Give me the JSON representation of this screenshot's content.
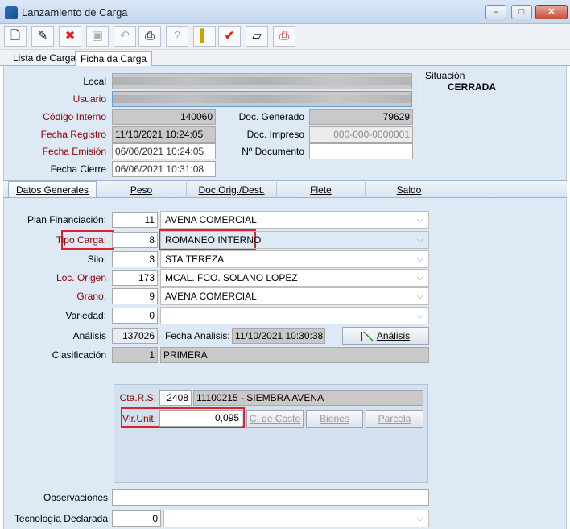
{
  "window": {
    "title": "Lanzamiento de Carga"
  },
  "toolbar": {
    "icons": [
      "new-document-icon",
      "edit-document-icon",
      "delete-document-icon",
      "save-icon",
      "undo-icon",
      "print-icon",
      "help-icon",
      "exit-icon",
      "confirm-icon",
      "eraser-icon",
      "print-report-icon"
    ]
  },
  "tabs": [
    {
      "label": "Lista de Cargas"
    },
    {
      "label": "Ficha da Carga"
    }
  ],
  "header": {
    "local_label": "Local",
    "usuario_label": "Usuario",
    "codigo_interno_label": "Código Interno",
    "codigo_interno": "140060",
    "doc_generado_label": "Doc. Generado",
    "doc_generado": "79629",
    "fecha_registro_label": "Fecha Registro",
    "fecha_registro": "11/10/2021 10:24:05",
    "doc_impreso_label": "Doc. Impreso",
    "doc_impreso": "000-000-0000001",
    "fecha_emision_label": "Fecha Emisión",
    "fecha_emision": "06/06/2021 10:24:05",
    "no_documento_label": "Nº Documento",
    "no_documento": "",
    "fecha_cierre_label": "Fecha Cierre",
    "fecha_cierre": "06/06/2021 10:31:08",
    "situacion_label": "Situación",
    "situacion": "CERRADA"
  },
  "subtabs": [
    {
      "label": "Datos Generales"
    },
    {
      "label": "Peso"
    },
    {
      "label": "Doc.Orig./Dest."
    },
    {
      "label": "Flete"
    },
    {
      "label": "Saldo"
    }
  ],
  "form": {
    "plan_financiacion": {
      "label": "Plan Financiación:",
      "code": "11",
      "value": "AVENA COMERCIAL"
    },
    "tipo_carga": {
      "label": "Tipo Carga:",
      "code": "8",
      "value": "ROMANEO INTERNO"
    },
    "silo": {
      "label": "Silo:",
      "code": "3",
      "value": "STA.TEREZA"
    },
    "loc_origen": {
      "label": "Loc. Origen",
      "code": "173",
      "value": "MCAL. FCO. SOLANO LOPEZ"
    },
    "grano": {
      "label": "Grano:",
      "code": "9",
      "value": "AVENA COMERCIAL"
    },
    "variedad": {
      "label": "Variedad:",
      "code": "0",
      "value": ""
    },
    "analisis": {
      "label": "Análisis",
      "code": "137026",
      "fecha_label": "Fecha Análisis:",
      "fecha": "11/10/2021 10:30:38",
      "button": "Análisis"
    },
    "clasificacion": {
      "label": "Clasificación",
      "code": "1",
      "value": "PRIMERA"
    },
    "cta_rs": {
      "label": "Cta.R.S.",
      "code": "2408",
      "value": "11100215 - SIEMBRA AVENA"
    },
    "vlr_unit": {
      "label": "Vlr.Unit.",
      "value": "0,095"
    },
    "buttons": {
      "c_costo": "C. de Costo",
      "bienes": "Bienes",
      "parcela": "Parcela"
    },
    "observaciones": {
      "label": "Observaciones",
      "value": ""
    },
    "tecnologia": {
      "label": "Tecnología Declarada",
      "code": "0",
      "value": ""
    }
  }
}
